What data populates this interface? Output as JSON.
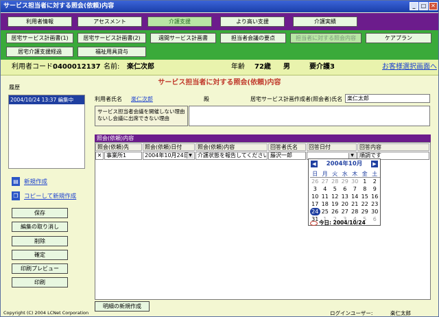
{
  "window": {
    "title": "サービス担当者に対する照会(依頼)内容"
  },
  "nav_row1": [
    {
      "label": "利用者情報"
    },
    {
      "label": "アセスメント"
    },
    {
      "label": "介護支援"
    },
    {
      "label": "より高い支援"
    },
    {
      "label": "介護実績"
    }
  ],
  "nav_row2": [
    {
      "label": "居宅サービス計画書(1)"
    },
    {
      "label": "居宅サービス計画書(2)"
    },
    {
      "label": "週間サービス計画書"
    },
    {
      "label": "担当者会議の要点"
    },
    {
      "label": "担当者に対する照会内容"
    },
    {
      "label": "ケアプラン"
    }
  ],
  "nav_row3": [
    {
      "label": "居宅介護支援経過"
    },
    {
      "label": "福祉用具貸与"
    }
  ],
  "info": {
    "user_code_label": "利用者コード:",
    "user_code": "0400012137",
    "name_label": "名前:",
    "name": "楽仁次郎",
    "age_label": "年齢",
    "age": "72歳",
    "gender": "男",
    "care_level": "要介護3",
    "back_link": "お客様選択画面へ"
  },
  "section_title": "サービス担当者に対する照会(依頼)内容",
  "history": {
    "label": "履歴",
    "items": [
      {
        "text": "2004/10/24 13:37 編集中"
      }
    ]
  },
  "form": {
    "user_name_label": "利用者氏名",
    "user_name": "楽仁次郎",
    "honorific": "殿",
    "author_label": "居宅サービス計画作成者(照会者)氏名",
    "author_value": "楽仁太郎",
    "reason_label": "サービス担当者会議を開催しない理由ないし会議に出席できない理由",
    "reason_value": ""
  },
  "links": {
    "new": "新規作成",
    "copy_new": "コピーして新規作成"
  },
  "actions": [
    "保存",
    "編集の取り消し",
    "削除",
    "確定",
    "印刷プレビュー",
    "印刷"
  ],
  "inquiry": {
    "header": "照会(依頼)内容",
    "columns": [
      "照会(依頼)先",
      "照会(依頼)日付",
      "照会(依頼)内容",
      "回答者氏名",
      "回答日付",
      "回答内容"
    ],
    "row": {
      "delete_mark": "✕",
      "destination": "事業所1",
      "date": "2004年10月24日",
      "content": "介護状態を報告してください",
      "answerer": "藤沢一郎",
      "answer_date": "",
      "answer_content": "順調です"
    }
  },
  "calendar": {
    "title": "2004年10月",
    "weekdays": [
      "日",
      "月",
      "火",
      "水",
      "木",
      "金",
      "土"
    ],
    "weeks": [
      [
        "26",
        "27",
        "28",
        "29",
        "30",
        "1",
        "2"
      ],
      [
        "3",
        "4",
        "5",
        "6",
        "7",
        "8",
        "9"
      ],
      [
        "10",
        "11",
        "12",
        "13",
        "14",
        "15",
        "16"
      ],
      [
        "17",
        "18",
        "19",
        "20",
        "21",
        "22",
        "23"
      ],
      [
        "24",
        "25",
        "26",
        "27",
        "28",
        "29",
        "30"
      ],
      [
        "31",
        "1",
        "2",
        "3",
        "4",
        "5",
        "6"
      ]
    ],
    "today_label": "今日: 2004/10/24"
  },
  "detail_button": "明細の新規作成",
  "footer": {
    "copyright": "Copyright (C) 2004 LCNet Corporation",
    "login_label": "ログインユーザー:",
    "login_user": "楽仁太郎"
  }
}
